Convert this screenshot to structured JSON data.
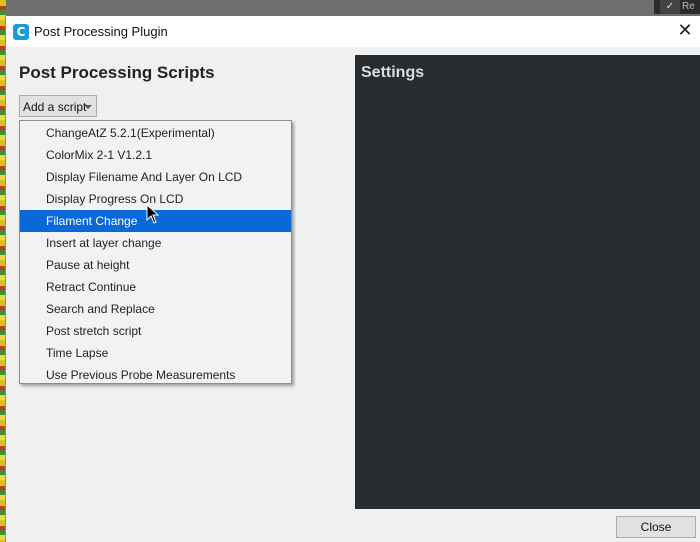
{
  "window": {
    "title": "Post Processing Plugin",
    "icon_name": "cura-logo-icon",
    "icon_letter": "C",
    "close_glyph": "✕"
  },
  "background_app": {
    "check_glyph": "✓",
    "partial_text": "Re"
  },
  "main": {
    "heading": "Post Processing Scripts",
    "add_script_label": "Add a script"
  },
  "dropdown": {
    "items": [
      "ChangeAtZ 5.2.1(Experimental)",
      "ColorMix 2-1 V1.2.1",
      "Display Filename And Layer On LCD",
      "Display Progress On LCD",
      "Filament Change",
      "Insert at layer change",
      "Pause at height",
      "Retract Continue",
      "Search and Replace",
      "Post stretch script",
      "Time Lapse",
      "Use Previous Probe Measurements"
    ],
    "selected": "Filament Change"
  },
  "settings": {
    "title": "Settings"
  },
  "footer": {
    "close_label": "Close"
  },
  "colors": {
    "selection": "#0a68d8",
    "settings_bg": "#272c31",
    "dialog_bg": "#f0f0f0"
  }
}
